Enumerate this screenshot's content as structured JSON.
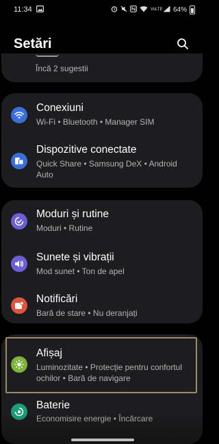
{
  "status_bar": {
    "time": "11:34",
    "network": "VoLTE",
    "battery": "64%",
    "icons": [
      "gallery-notification-icon",
      "alarm-icon",
      "mute-icon",
      "nfc-icon",
      "wifi-icon",
      "signal-icon",
      "battery-icon"
    ]
  },
  "header": {
    "title": "Setări",
    "search_icon": "search-icon"
  },
  "suggestions": {
    "more": "Încă 2 sugestii"
  },
  "groups": [
    {
      "items": [
        {
          "title": "Conexiuni",
          "subtitle": "Wi-Fi  •  Bluetooth  •  Manager SIM",
          "icon": "wifi-icon",
          "color": "#3a6fd8"
        },
        {
          "title": "Dispozitive conectate",
          "subtitle": "Quick Share  •  Samsung DeX  •  Android Auto",
          "icon": "connected-devices-icon",
          "color": "#3a6fd8"
        }
      ]
    },
    {
      "items": [
        {
          "title": "Moduri și rutine",
          "subtitle": "Moduri  •  Rutine",
          "icon": "modes-routines-icon",
          "color": "#6c5fd4"
        },
        {
          "title": "Sunete și vibrații",
          "subtitle": "Mod sunet  •  Ton de apel",
          "icon": "volume-icon",
          "color": "#6c5fd4"
        },
        {
          "title": "Notificări",
          "subtitle": "Bară de stare  •  Nu deranjați",
          "icon": "notification-icon",
          "color": "#e0553f"
        }
      ]
    },
    {
      "items": [
        {
          "title": "Afișaj",
          "subtitle": "Luminozitate  •  Protecție pentru confortul ochilor  •  Bară de navigare",
          "icon": "brightness-icon",
          "color": "#7db33a",
          "highlighted": true
        },
        {
          "title": "Baterie",
          "subtitle": "Economisire energie  •  Încărcare",
          "icon": "battery-icon",
          "color": "#1f9d7a"
        }
      ]
    }
  ]
}
